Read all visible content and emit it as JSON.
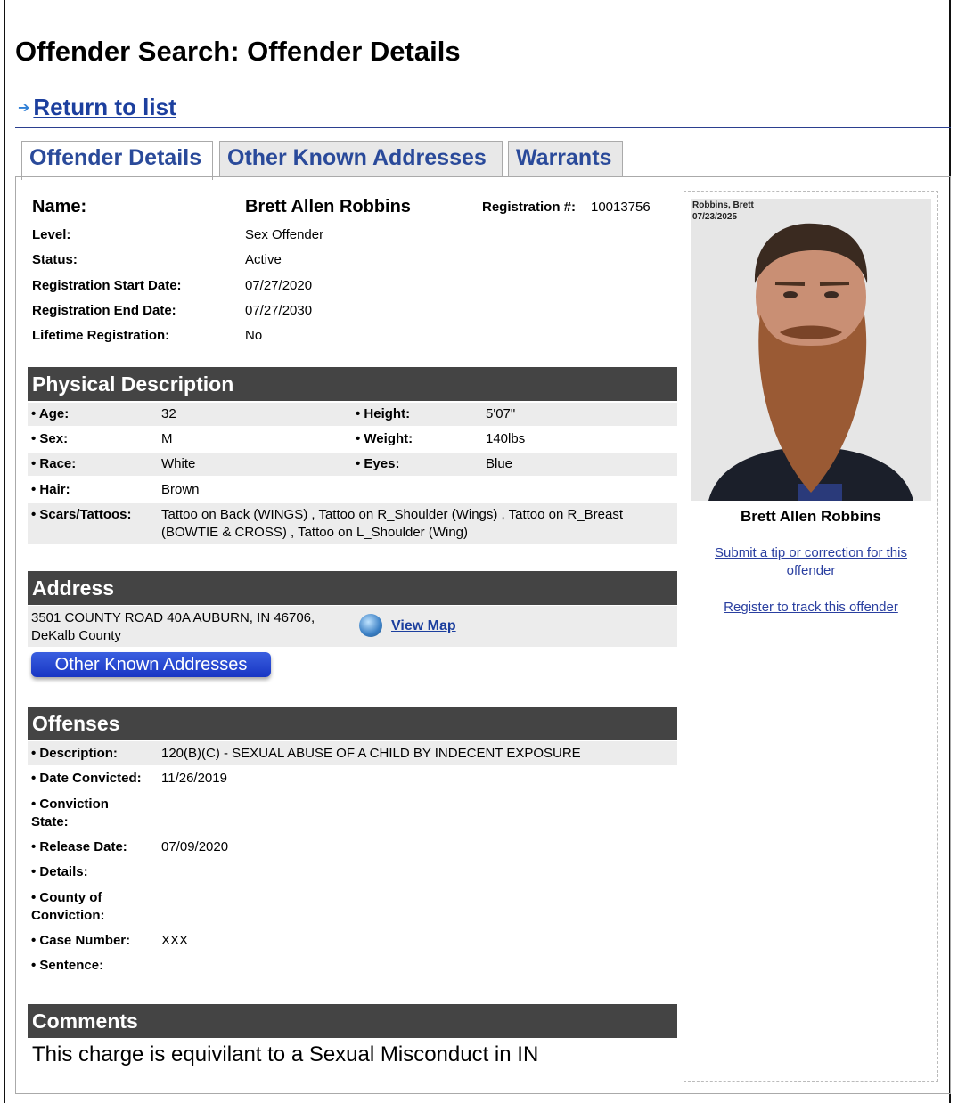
{
  "page": {
    "title": "Offender Search: Offender Details",
    "return_label": "Return to list"
  },
  "tabs": [
    "Offender Details",
    "Other Known Addresses",
    "Warrants"
  ],
  "summary": {
    "name_label": "Name:",
    "name": "Brett Allen Robbins",
    "reg_label": "Registration #:",
    "reg_number": "10013756",
    "rows": [
      {
        "label": "Level:",
        "value": "Sex Offender"
      },
      {
        "label": "Status:",
        "value": "Active"
      },
      {
        "label": "Registration Start Date:",
        "value": "07/27/2020"
      },
      {
        "label": "Registration End Date:",
        "value": "07/27/2030"
      },
      {
        "label": "Lifetime Registration:",
        "value": "No"
      }
    ]
  },
  "physical": {
    "header": "Physical Description",
    "age_label": "• Age:",
    "age": "32",
    "height_label": "• Height:",
    "height": "5'07\"",
    "sex_label": "• Sex:",
    "sex": "M",
    "weight_label": "• Weight:",
    "weight": "140lbs",
    "race_label": "• Race:",
    "race": "White",
    "eyes_label": "• Eyes:",
    "eyes": "Blue",
    "hair_label": "• Hair:",
    "hair": "Brown",
    "scars_label": "• Scars/Tattoos:",
    "scars_line1": "Tattoo on Back (WINGS) , Tattoo on R_Shoulder (Wings) , Tattoo on R_Breast",
    "scars_line2": "(BOWTIE & CROSS) , Tattoo on L_Shoulder (Wing)"
  },
  "address": {
    "header": "Address",
    "line1": "3501 COUNTY ROAD 40A AUBURN, IN 46706,",
    "line2": "DeKalb County",
    "view_map": "View Map",
    "oka_button": "Other Known Addresses"
  },
  "offenses": {
    "header": "Offenses",
    "description_label": "• Description:",
    "description": "120(B)(C) - SEXUAL ABUSE OF A CHILD BY INDECENT EXPOSURE",
    "convicted_label": "• Date Convicted:",
    "convicted": "11/26/2019",
    "state_label1": "• Conviction",
    "state_label2": "State:",
    "release_label": "• Release Date:",
    "release": "07/09/2020",
    "details_label": "• Details:",
    "county_label1": "• County of",
    "county_label2": "Conviction:",
    "case_label": "• Case Number:",
    "case": "XXX",
    "sentence_label": "• Sentence:"
  },
  "comments": {
    "header": "Comments",
    "text": "This charge is equivilant to a Sexual Misconduct in IN"
  },
  "sidebar": {
    "photo_caption1": "Robbins, Brett",
    "photo_caption2": "07/23/2025",
    "name": "Brett Allen Robbins",
    "tip_link1": "Submit a tip or correction for this",
    "tip_link2": "offender",
    "register_link": "Register to track this offender"
  },
  "colors": {
    "link": "#1c3f9e",
    "header_bg": "#444444",
    "button": "#2544d0"
  }
}
